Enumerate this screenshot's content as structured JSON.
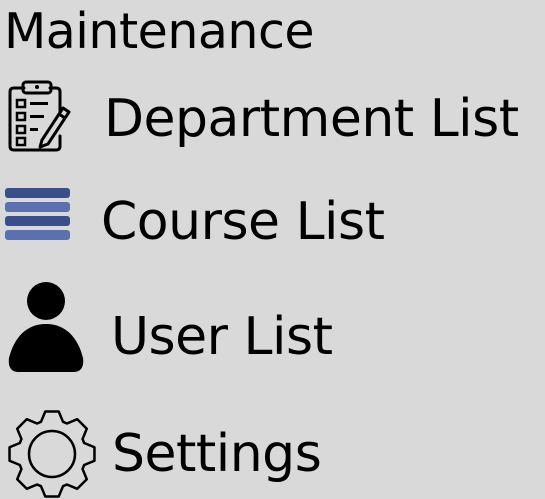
{
  "header": {
    "title": "Maintenance"
  },
  "menu": {
    "items": [
      {
        "label": "Department List",
        "icon": "clipboard-edit-icon"
      },
      {
        "label": "Course List",
        "icon": "stacked-bars-icon"
      },
      {
        "label": "User List",
        "icon": "user-icon"
      },
      {
        "label": "Settings",
        "icon": "gear-icon"
      }
    ]
  },
  "colors": {
    "background": "#d9d9d9",
    "text": "#000000",
    "course_icon_dark": "#3a4f8a",
    "course_icon_light": "#5a70b0"
  }
}
